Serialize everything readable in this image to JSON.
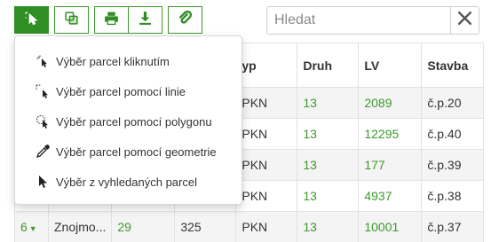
{
  "toolbar": {
    "buttons": [
      {
        "icon": "pointer-select-icon",
        "active": true
      },
      {
        "icon": "layers-copy-icon",
        "active": false
      },
      {
        "icon": "printer-icon",
        "active": false
      },
      {
        "icon": "download-icon",
        "active": false
      },
      {
        "icon": "paperclip-icon",
        "active": false
      }
    ]
  },
  "search": {
    "placeholder": "Hledat",
    "value": "",
    "clear_icon": "close-icon"
  },
  "dropdown": {
    "items": [
      {
        "label": "Výběr parcel kliknutím",
        "icon": "click-cursor-icon"
      },
      {
        "label": "Výběr parcel pomocí linie",
        "icon": "line-cursor-icon"
      },
      {
        "label": "Výběr parcel pomocí polygonu",
        "icon": "polygon-cursor-icon"
      },
      {
        "label": "Výběr parcel pomocí geometrie",
        "icon": "eyedropper-icon"
      },
      {
        "label": "Výběr z vyhledaných parcel",
        "icon": "arrow-cursor-icon"
      }
    ]
  },
  "table": {
    "headers": [
      "",
      "",
      "",
      "",
      "yp",
      "Druh",
      "LV",
      "Stavba"
    ],
    "rows": [
      {
        "num": "",
        "area": "",
        "parcel": "",
        "size": "",
        "type": "PKN",
        "druh": "13",
        "lv": "2089",
        "stavba": "č.p.20"
      },
      {
        "num": "",
        "area": "",
        "parcel": "",
        "size": "",
        "type": "PKN",
        "druh": "13",
        "lv": "12295",
        "stavba": "č.p.40"
      },
      {
        "num": "",
        "area": "",
        "parcel": "",
        "size": "",
        "type": "PKN",
        "druh": "13",
        "lv": "177",
        "stavba": "č.p.39"
      },
      {
        "num": "",
        "area": "",
        "parcel": "",
        "size": "",
        "type": "PKN",
        "druh": "13",
        "lv": "4937",
        "stavba": "č.p.38"
      },
      {
        "num": "6",
        "area": "Znojmo...",
        "parcel": "29",
        "size": "325",
        "type": "PKN",
        "druh": "13",
        "lv": "10001",
        "stavba": "č.p.37"
      }
    ]
  },
  "colors": {
    "accent": "#2f8f22",
    "link": "#3c9a2b"
  }
}
